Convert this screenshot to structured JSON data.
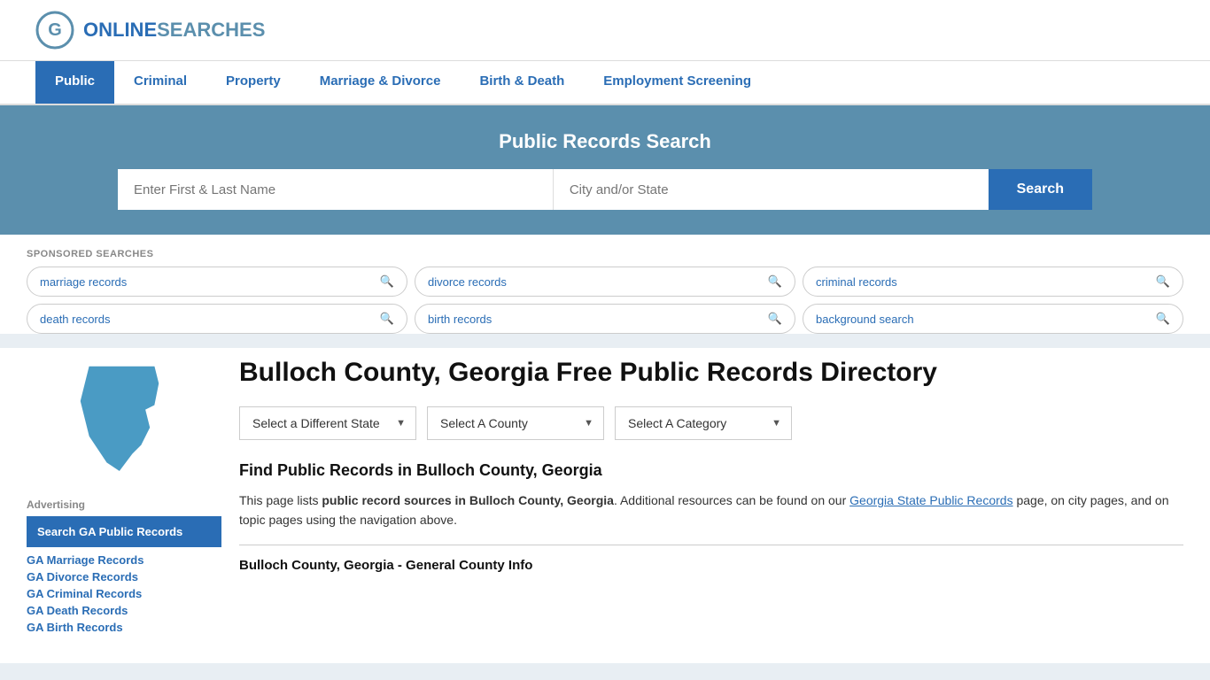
{
  "header": {
    "logo_text_plain": "ONLINE",
    "logo_text_colored": "SEARCHES"
  },
  "nav": {
    "items": [
      {
        "label": "Public",
        "active": true
      },
      {
        "label": "Criminal",
        "active": false
      },
      {
        "label": "Property",
        "active": false
      },
      {
        "label": "Marriage & Divorce",
        "active": false
      },
      {
        "label": "Birth & Death",
        "active": false
      },
      {
        "label": "Employment Screening",
        "active": false
      }
    ]
  },
  "search_banner": {
    "title": "Public Records Search",
    "name_placeholder": "Enter First & Last Name",
    "location_placeholder": "City and/or State",
    "button_label": "Search"
  },
  "sponsored": {
    "label": "SPONSORED SEARCHES",
    "tags": [
      {
        "text": "marriage records"
      },
      {
        "text": "divorce records"
      },
      {
        "text": "criminal records"
      },
      {
        "text": "death records"
      },
      {
        "text": "birth records"
      },
      {
        "text": "background search"
      }
    ]
  },
  "page": {
    "title": "Bulloch County, Georgia Free Public Records Directory",
    "dropdowns": {
      "state": "Select a Different State",
      "county": "Select A County",
      "category": "Select A Category"
    },
    "find_title": "Find Public Records in Bulloch County, Georgia",
    "find_text_1": "This page lists ",
    "find_text_bold": "public record sources in Bulloch County, Georgia",
    "find_text_2": ". Additional resources can be found on our ",
    "find_link_text": "Georgia State Public Records",
    "find_text_3": " page, on city pages, and on topic pages using the navigation above.",
    "general_info_title": "Bulloch County, Georgia - General County Info"
  },
  "sidebar": {
    "ad_label": "Advertising",
    "ad_link_text": "Search GA Public Records",
    "ad_links": [
      "GA Marriage Records",
      "GA Divorce Records",
      "GA Criminal Records",
      "GA Death Records",
      "GA Birth Records"
    ]
  },
  "colors": {
    "primary_blue": "#2a6db5",
    "banner_blue": "#5b8fad",
    "active_nav": "#2a6db5"
  }
}
